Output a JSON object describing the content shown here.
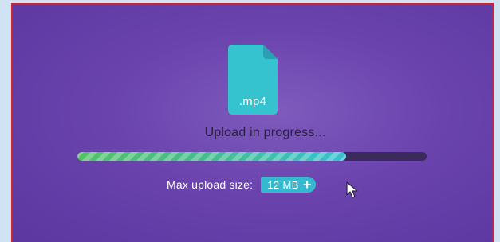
{
  "upload": {
    "file_type": ".mp4",
    "status": "Upload in progress...",
    "progress": 0.77,
    "max_size_label": "Max upload size:",
    "max_size_value": "12 MB"
  },
  "icons": {
    "file": "file-icon",
    "increase": "plus-icon",
    "pointer": "cursor-icon"
  },
  "colors": {
    "background": "#6a43ad",
    "file_icon": "#35c3d0",
    "progress_start": "#52c264",
    "progress_end": "#35c3d0",
    "progress_track": "#3b2a5c",
    "pill": "#35b9cf",
    "frame_border": "#c8252e"
  }
}
